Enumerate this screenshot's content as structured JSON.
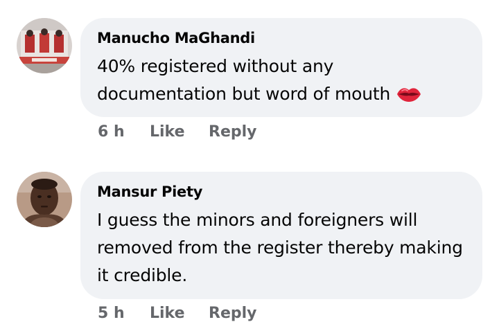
{
  "comments": [
    {
      "author": "Manucho MaGhandi",
      "text": "40% registered without any documentation but word of mouth",
      "emoji": "lips-icon",
      "time": "6 h",
      "like_label": "Like",
      "reply_label": "Reply"
    },
    {
      "author": "Mansur Piety",
      "text": "I guess the minors and foreigners will removed from the register thereby making it credible.",
      "time": "5 h",
      "like_label": "Like",
      "reply_label": "Reply"
    }
  ],
  "colors": {
    "bubble": "#f0f2f5",
    "text": "#050505",
    "meta": "#65676b"
  }
}
